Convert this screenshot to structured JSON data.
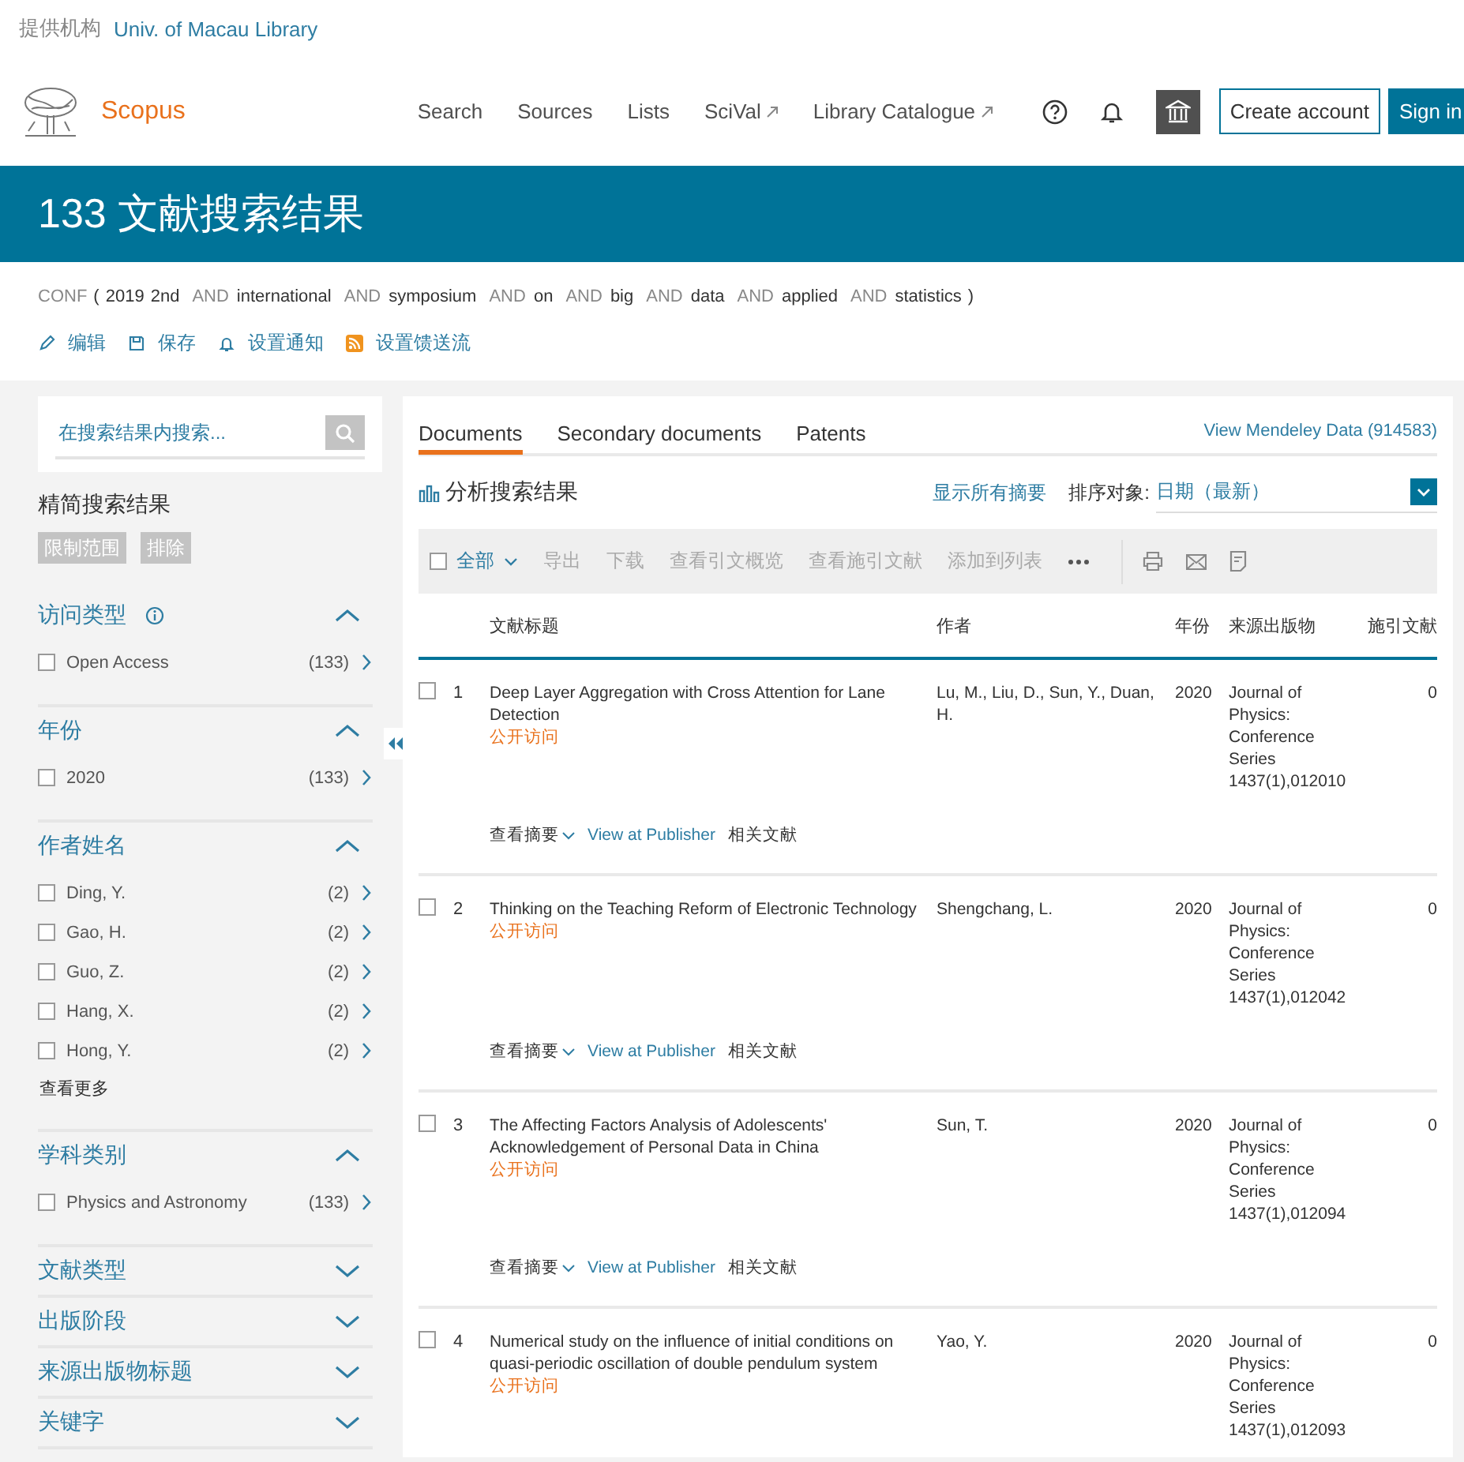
{
  "institution": {
    "label": "提供机构",
    "name": "Univ. of Macau Library"
  },
  "header": {
    "brand": "Scopus",
    "nav": [
      {
        "label": "Search",
        "external": false
      },
      {
        "label": "Sources",
        "external": false
      },
      {
        "label": "Lists",
        "external": false
      },
      {
        "label": "SciVal",
        "external": true
      },
      {
        "label": "Library Catalogue",
        "external": true
      }
    ],
    "buttons": [
      {
        "label": "Create account",
        "kind": "outline"
      },
      {
        "label": "Sign in",
        "kind": "filled"
      }
    ]
  },
  "banner": {
    "title": "133 文献搜索结果"
  },
  "query": [
    {
      "text": "CONF",
      "kind": "field"
    },
    {
      "text": "(",
      "kind": "paren"
    },
    {
      "text": "2019",
      "kind": "term"
    },
    {
      "text": "2nd",
      "kind": "term"
    },
    {
      "text": "AND",
      "kind": "operator"
    },
    {
      "text": "international",
      "kind": "term"
    },
    {
      "text": "AND",
      "kind": "operator"
    },
    {
      "text": "symposium",
      "kind": "term"
    },
    {
      "text": "AND",
      "kind": "operator"
    },
    {
      "text": "on",
      "kind": "term"
    },
    {
      "text": "AND",
      "kind": "operator"
    },
    {
      "text": "big",
      "kind": "term"
    },
    {
      "text": "AND",
      "kind": "operator"
    },
    {
      "text": "data",
      "kind": "term"
    },
    {
      "text": "AND",
      "kind": "operator"
    },
    {
      "text": "applied",
      "kind": "term"
    },
    {
      "text": "AND",
      "kind": "operator"
    },
    {
      "text": "statistics",
      "kind": "term"
    },
    {
      "text": ")",
      "kind": "paren"
    }
  ],
  "query_actions": [
    {
      "label": "编辑",
      "kind": "edit"
    },
    {
      "label": "保存",
      "kind": "save"
    },
    {
      "label": "设置通知",
      "kind": "alert"
    },
    {
      "label": "设置馈送流",
      "kind": "feed"
    }
  ],
  "sidebar": {
    "search": {
      "placeholder": "在搜索结果内搜索..."
    },
    "title": "精简搜索结果",
    "buttons": [
      {
        "label": "限制范围",
        "disabled": true
      },
      {
        "label": "排除",
        "disabled": true
      }
    ],
    "sections": [
      {
        "title": "访问类型",
        "info": true,
        "expanded": true,
        "items": [
          {
            "label": "Open Access",
            "count": "(133)",
            "checked": false
          }
        ]
      },
      {
        "title": "年份",
        "info": false,
        "expanded": true,
        "items": [
          {
            "label": "2020",
            "count": "(133)",
            "checked": false
          }
        ]
      },
      {
        "title": "作者姓名",
        "info": false,
        "expanded": true,
        "items": [
          {
            "label": "Ding, Y.",
            "count": "(2)",
            "checked": false
          },
          {
            "label": "Gao, H.",
            "count": "(2)",
            "checked": false
          },
          {
            "label": "Guo, Z.",
            "count": "(2)",
            "checked": false
          },
          {
            "label": "Hang, X.",
            "count": "(2)",
            "checked": false
          },
          {
            "label": "Hong, Y.",
            "count": "(2)",
            "checked": false
          }
        ],
        "more": "查看更多"
      },
      {
        "title": "学科类别",
        "info": false,
        "expanded": true,
        "items": [
          {
            "label": "Physics and Astronomy",
            "count": "(133)",
            "checked": false
          }
        ]
      },
      {
        "title": "文献类型",
        "info": false,
        "expanded": false
      },
      {
        "title": "出版阶段",
        "info": false,
        "expanded": false
      },
      {
        "title": "来源出版物标题",
        "info": false,
        "expanded": false
      },
      {
        "title": "关键字",
        "info": false,
        "expanded": false
      }
    ]
  },
  "results": {
    "tabs": [
      {
        "label": "Documents",
        "selected": true
      },
      {
        "label": "Secondary documents",
        "selected": false
      },
      {
        "label": "Patents",
        "selected": false
      }
    ],
    "mendeley": "View Mendeley Data (914583)",
    "analyze": "分析搜索结果",
    "show_abstracts": "显示所有摘要",
    "sort": {
      "label": "排序对象:",
      "value": "日期（最新）"
    },
    "toolbar": {
      "select_all": {
        "label": "全部",
        "checked": false
      },
      "actions": [
        {
          "label": "导出",
          "disabled": true
        },
        {
          "label": "下载",
          "disabled": true
        },
        {
          "label": "查看引文概览",
          "disabled": true
        },
        {
          "label": "查看施引文献",
          "disabled": true
        },
        {
          "label": "添加到列表",
          "disabled": true
        }
      ]
    },
    "columns": [
      "文献标题",
      "作者",
      "年份",
      "来源出版物",
      "施引文献"
    ],
    "rows": [
      {
        "number": "1",
        "checked": false,
        "title": "Deep Layer Aggregation with Cross Attention for Lane Detection",
        "access": "公开访问",
        "authors": "Lu, M., Liu, D., Sun, Y., Duan, H.",
        "year": "2020",
        "source": "Journal of Physics: Conference Series 1437(1),012010",
        "cited": "0",
        "actions": {
          "abstract": "查看摘要",
          "publisher": "View at Publisher",
          "related": "相关文献"
        }
      },
      {
        "number": "2",
        "checked": false,
        "title": "Thinking on the Teaching Reform of Electronic Technology",
        "access": "公开访问",
        "authors": "Shengchang, L.",
        "year": "2020",
        "source": "Journal of Physics: Conference Series 1437(1),012042",
        "cited": "0",
        "actions": {
          "abstract": "查看摘要",
          "publisher": "View at Publisher",
          "related": "相关文献"
        }
      },
      {
        "number": "3",
        "checked": false,
        "title": "The Affecting Factors Analysis of Adolescents' Acknowledgement of Personal Data in China",
        "access": "公开访问",
        "authors": "Sun, T.",
        "year": "2020",
        "source": "Journal of Physics: Conference Series 1437(1),012094",
        "cited": "0",
        "actions": {
          "abstract": "查看摘要",
          "publisher": "View at Publisher",
          "related": "相关文献"
        }
      },
      {
        "number": "4",
        "checked": false,
        "title": "Numerical study on the influence of initial conditions on quasi-periodic oscillation of double pendulum system",
        "access": "公开访问",
        "authors": "Yao, Y.",
        "year": "2020",
        "source": "Journal of Physics: Conference Series 1437(1),012093",
        "cited": "0"
      }
    ]
  }
}
